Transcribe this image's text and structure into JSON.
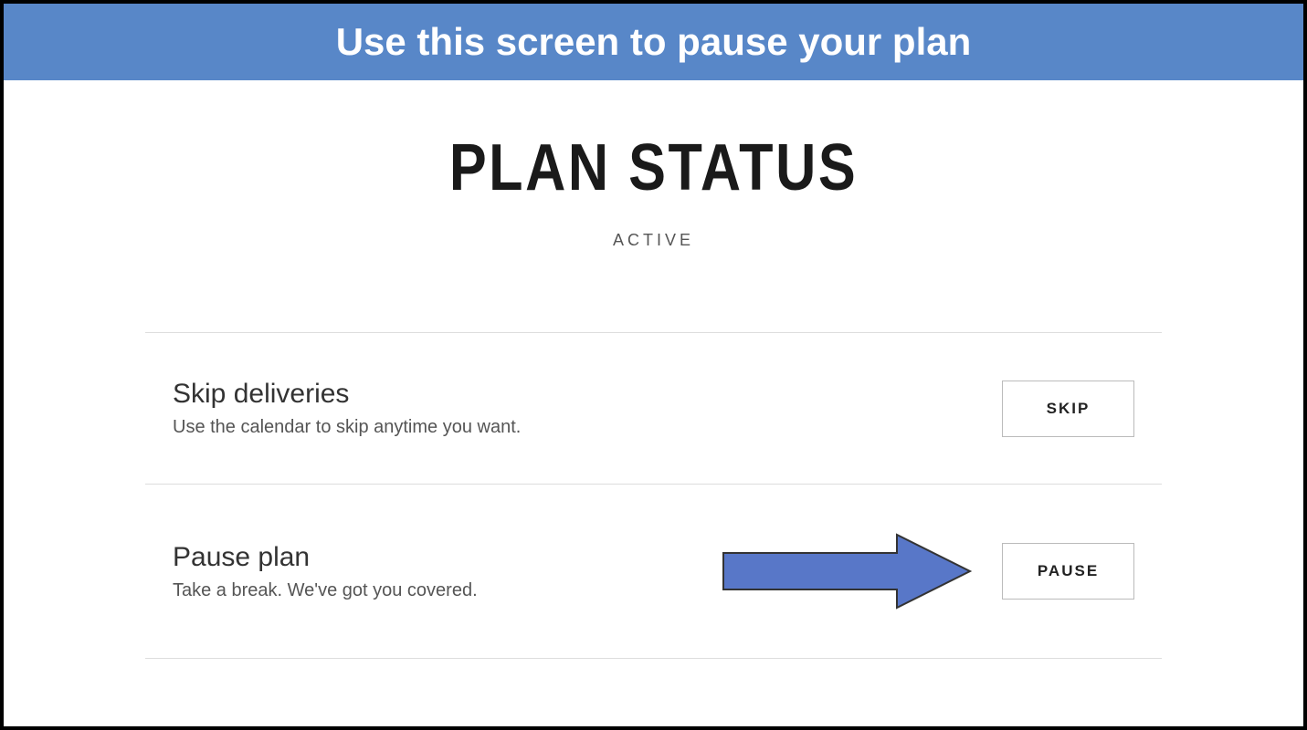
{
  "banner": {
    "text": "Use this screen to pause your plan",
    "bg_color": "#5887c8"
  },
  "header": {
    "title": "PLAN STATUS",
    "status": "ACTIVE"
  },
  "rows": [
    {
      "title": "Skip deliveries",
      "desc": "Use the calendar to skip anytime you want.",
      "button_label": "SKIP",
      "show_arrow": false
    },
    {
      "title": "Pause plan",
      "desc": "Take a break. We've got you covered.",
      "button_label": "PAUSE",
      "show_arrow": true
    }
  ],
  "arrow": {
    "fill": "#5877c8",
    "stroke": "#333"
  }
}
